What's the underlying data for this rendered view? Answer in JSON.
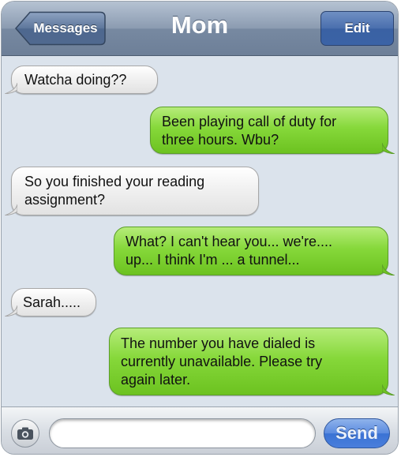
{
  "header": {
    "title": "Mom",
    "back_label": "Messages",
    "edit_label": "Edit"
  },
  "messages": [
    {
      "direction": "incoming",
      "text": "Watcha doing??"
    },
    {
      "direction": "outgoing",
      "text": "Been playing call of duty for\nthree hours. Wbu?"
    },
    {
      "direction": "incoming",
      "text": "So you finished your reading\nassignment?"
    },
    {
      "direction": "outgoing",
      "text": "What? I can't hear you... we're....\nup... I think I'm ... a tunnel..."
    },
    {
      "direction": "incoming",
      "text": "Sarah....."
    },
    {
      "direction": "outgoing",
      "text": "The number you have dialed is\ncurrently unavailable. Please try\nagain later."
    }
  ],
  "composer": {
    "camera_icon": "camera-icon",
    "input_value": "",
    "input_placeholder": "",
    "send_label": "Send"
  },
  "colors": {
    "incoming_bubble": "#e6e6e6",
    "outgoing_bubble": "#86d83a",
    "background": "#dbe3ec",
    "navbar": "#7f90a8",
    "send_button": "#4a7fdc"
  }
}
